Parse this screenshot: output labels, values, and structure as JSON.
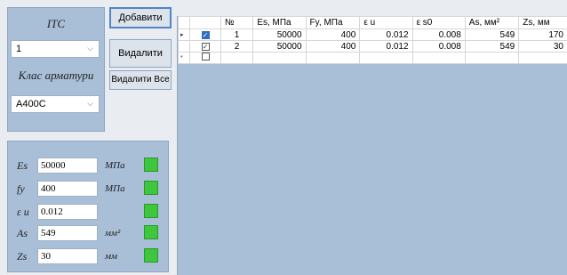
{
  "top_group": {
    "title": "ІТС",
    "selected": "1",
    "class_label": "Клас арматури",
    "class_value": "A400C"
  },
  "buttons": {
    "add": "Добавити",
    "delete": "Видалити",
    "delete_all": "Видалити Все"
  },
  "fields": [
    {
      "label": "Es",
      "value": "50000",
      "unit": "МПа",
      "status": "#3ec63e"
    },
    {
      "label": "fy",
      "value": "400",
      "unit": "МПа",
      "status": "#3ec63e"
    },
    {
      "label": "ε u",
      "value": "0.012",
      "unit": "",
      "status": "#3ec63e"
    },
    {
      "label": "As",
      "value": "549",
      "unit": "мм²",
      "status": "#3ec63e"
    },
    {
      "label": "Zs",
      "value": "30",
      "unit": "мм",
      "status": "#3ec63e"
    }
  ],
  "grid": {
    "headers": [
      "№",
      "Es, МПа",
      "Fy, МПа",
      "ε u",
      "ε s0",
      "As, мм²",
      "Zs, мм"
    ],
    "rows": [
      {
        "marker": "▸",
        "checked": true,
        "selected": true,
        "cells": [
          "1",
          "50000",
          "400",
          "0.012",
          "0.008",
          "549",
          "170"
        ]
      },
      {
        "marker": "",
        "checked": true,
        "selected": false,
        "cells": [
          "2",
          "50000",
          "400",
          "0.012",
          "0.008",
          "549",
          "30"
        ]
      }
    ],
    "new_row_marker": "*"
  },
  "colors": {
    "panel": "#a9bfd8",
    "status_ok": "#3ec63e",
    "accent": "#4f85c9"
  }
}
